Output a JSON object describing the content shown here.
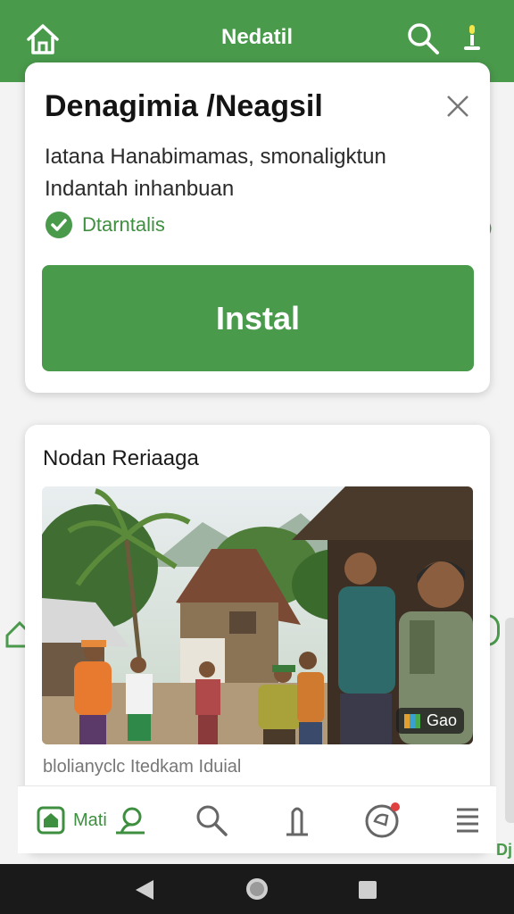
{
  "app_bar": {
    "title": "Nedatil",
    "home_icon": "home-icon",
    "search_icon": "search-icon",
    "mic_icon": "mic-icon"
  },
  "install_card": {
    "app_name": "Denagimia /Neagsil",
    "description_line1": "Iatana Hanabimamas, smonaligktun",
    "description_line2": "Indantah inhanbuan",
    "verified_label": "Dtarntalis",
    "install_label": "Instal",
    "close_icon": "close-icon"
  },
  "feature_card": {
    "section_title": "Nodan Reriaaga",
    "badge_text": "Gao",
    "caption": "blolianyclc Itedkam Iduial"
  },
  "bottom_nav": {
    "home_label": "Mati",
    "items": [
      "home-icon",
      "profile-icon",
      "search-icon",
      "bookmark-icon",
      "notifications-icon",
      "menu-icon"
    ]
  },
  "peek": {
    "right_text": "Dj"
  },
  "colors": {
    "brand_green": "#4a9a4c",
    "system_bar": "#1a1a1a"
  }
}
